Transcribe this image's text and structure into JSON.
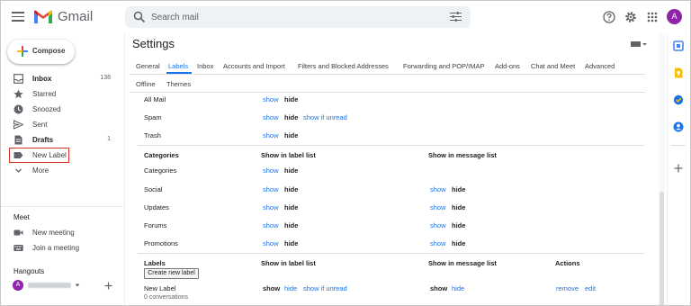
{
  "app": {
    "brand": "Gmail",
    "avatar_letter": "A"
  },
  "search": {
    "placeholder": "Search mail"
  },
  "sidebar": {
    "compose": "Compose",
    "items": [
      {
        "label": "Inbox",
        "count": "138",
        "bold": true,
        "icon": "inbox-icon"
      },
      {
        "label": "Starred",
        "count": "",
        "bold": false,
        "icon": "star-icon"
      },
      {
        "label": "Snoozed",
        "count": "",
        "bold": false,
        "icon": "clock-icon"
      },
      {
        "label": "Sent",
        "count": "",
        "bold": false,
        "icon": "send-icon"
      },
      {
        "label": "Drafts",
        "count": "1",
        "bold": true,
        "icon": "draft-icon"
      },
      {
        "label": "New Label",
        "count": "",
        "bold": false,
        "icon": "label-icon"
      },
      {
        "label": "More",
        "count": "",
        "bold": false,
        "icon": "chevron-down-icon"
      }
    ],
    "meet": {
      "title": "Meet",
      "new_meeting": "New meeting",
      "join_meeting": "Join a meeting"
    },
    "hangouts": {
      "title": "Hangouts",
      "avatar_letter": "A"
    }
  },
  "settings": {
    "title": "Settings",
    "tabs": [
      "General",
      "Labels",
      "Inbox",
      "Accounts and Import",
      "Filters and Blocked Addresses",
      "Forwarding and POP/IMAP",
      "Add-ons",
      "Chat and Meet",
      "Advanced",
      "Offline",
      "Themes"
    ],
    "active_tab": "Labels",
    "system_rows": [
      {
        "name": "All Mail",
        "show": "show",
        "hide": "hide",
        "unread": ""
      },
      {
        "name": "Spam",
        "show": "show",
        "hide": "hide",
        "unread": "show if unread"
      },
      {
        "name": "Trash",
        "show": "show",
        "hide": "hide",
        "unread": ""
      }
    ],
    "categories_header": {
      "col1": "Categories",
      "col2": "Show in label list",
      "col3": "Show in message list"
    },
    "category_rows": [
      {
        "name": "Categories",
        "show": "show",
        "hide": "hide",
        "msg_show": "",
        "msg_hide": ""
      },
      {
        "name": "Social",
        "show": "show",
        "hide": "hide",
        "msg_show": "show",
        "msg_hide": "hide"
      },
      {
        "name": "Updates",
        "show": "show",
        "hide": "hide",
        "msg_show": "show",
        "msg_hide": "hide"
      },
      {
        "name": "Forums",
        "show": "show",
        "hide": "hide",
        "msg_show": "show",
        "msg_hide": "hide"
      },
      {
        "name": "Promotions",
        "show": "show",
        "hide": "hide",
        "msg_show": "show",
        "msg_hide": "hide"
      }
    ],
    "labels_header": {
      "col1": "Labels",
      "col2": "Show in label list",
      "col3": "Show in message list",
      "col4": "Actions"
    },
    "create_button": "Create new label",
    "label_row": {
      "name": "New Label",
      "sub": "0 conversations",
      "show": "show",
      "hide": "hide",
      "unread": "show if unread",
      "msg_show": "show",
      "msg_hide": "hide",
      "remove": "remove",
      "edit": "edit"
    }
  },
  "colors": {
    "link": "#1a73e8",
    "highlight": "#d93025",
    "avatar": "#8e24aa"
  }
}
